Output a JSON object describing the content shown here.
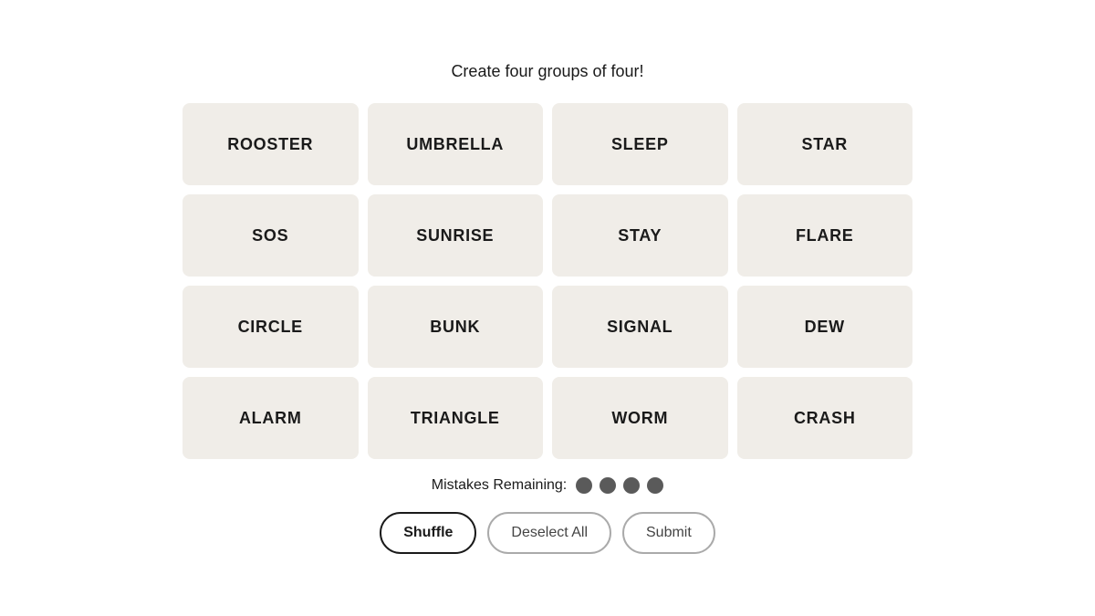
{
  "page": {
    "instruction": "Create four groups of four!",
    "grid": {
      "tiles": [
        {
          "id": 0,
          "label": "ROOSTER"
        },
        {
          "id": 1,
          "label": "UMBRELLA"
        },
        {
          "id": 2,
          "label": "SLEEP"
        },
        {
          "id": 3,
          "label": "STAR"
        },
        {
          "id": 4,
          "label": "SOS"
        },
        {
          "id": 5,
          "label": "SUNRISE"
        },
        {
          "id": 6,
          "label": "STAY"
        },
        {
          "id": 7,
          "label": "FLARE"
        },
        {
          "id": 8,
          "label": "CIRCLE"
        },
        {
          "id": 9,
          "label": "BUNK"
        },
        {
          "id": 10,
          "label": "SIGNAL"
        },
        {
          "id": 11,
          "label": "DEW"
        },
        {
          "id": 12,
          "label": "ALARM"
        },
        {
          "id": 13,
          "label": "TRIANGLE"
        },
        {
          "id": 14,
          "label": "WORM"
        },
        {
          "id": 15,
          "label": "CRASH"
        }
      ]
    },
    "mistakes": {
      "label": "Mistakes Remaining:",
      "count": 4
    },
    "buttons": {
      "shuffle": "Shuffle",
      "deselect_all": "Deselect All",
      "submit": "Submit"
    }
  }
}
